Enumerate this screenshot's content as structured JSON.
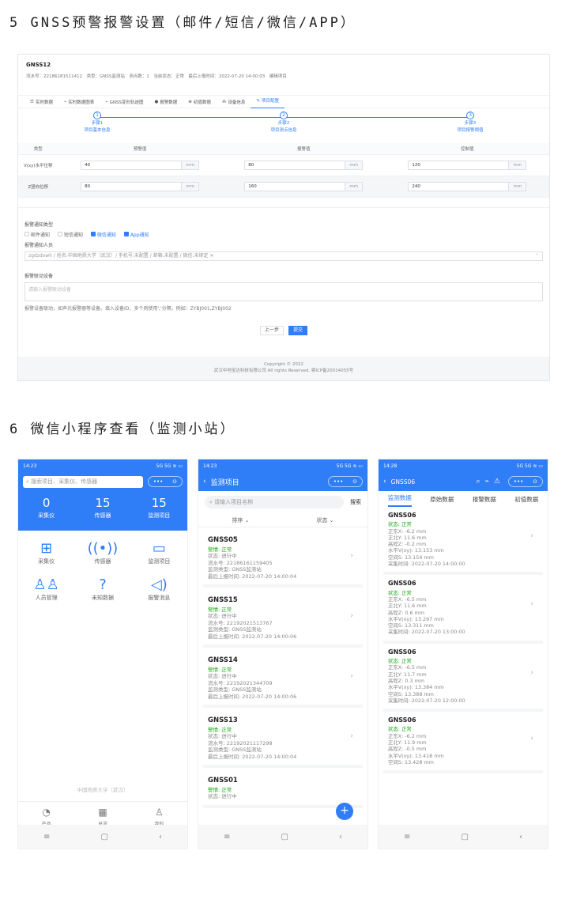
{
  "sec5_title": "5 GNSS预警报警设置（邮件/短信/微信/APP）",
  "sec6_title": "6 微信小程序查看（监测小站）",
  "web": {
    "name": "GNSS12",
    "meta": "流水号：22186181511412　类型：GNSS监测站　测点数：1　当前状态：正常　最后上报时间：2022-07-20 14:00:03　编辑项目",
    "tabs": [
      "实时数据",
      "实时数据图表",
      "GNSS变形轨迹图",
      "报警数据",
      "初值数据",
      "设备信息",
      "项目配置"
    ],
    "steps": [
      {
        "n": "1",
        "t1": "步骤1",
        "t2": "项目基本信息"
      },
      {
        "n": "2",
        "t1": "步骤2",
        "t2": "项目测点信息"
      },
      {
        "n": "3",
        "t1": "步骤3",
        "t2": "项目报警阈值"
      }
    ],
    "table_headers": [
      "类型",
      "预警值",
      "报警值",
      "控制值"
    ],
    "rows": [
      {
        "type": "V(xy)水平位移",
        "warn": "40",
        "alarm": "80",
        "control": "120",
        "unit": "mm"
      },
      {
        "type": "Z竖向位移",
        "warn": "80",
        "alarm": "160",
        "control": "240",
        "unit": "mm"
      }
    ],
    "notify_type_label": "报警通知类型",
    "notify_options": [
      "邮件通知",
      "短信通知",
      "微信通知",
      "App通知"
    ],
    "notify_person_label": "报警通知人员",
    "notify_person_value": "zgdzdxwh / 姓名:中国地质大学（武汉）/ 手机号:未配置 / 邮箱:未配置 / 微信:未绑定 ✕",
    "linkage_label": "报警联动设备",
    "linkage_placeholder": "请输入报警联动设备",
    "linkage_hint": "报警设备联动，如声光报警器等设备。填入设备ID，多个则使用','分隔，例如：ZYBJ001,ZYBJ002",
    "btn_prev": "上一步",
    "btn_submit": "提交",
    "footer1": "Copyright © 2022",
    "footer2": "武汉中地宝达科技有限公司 All rights Reserved.  鄂ICP备20014055号"
  },
  "phone1": {
    "time": "14:23",
    "signal": "5G 5G ≋ ▭",
    "search_placeholder": "搜索项目、采集仪、传感器",
    "stats": [
      {
        "n": "0",
        "l": "采集仪"
      },
      {
        "n": "15",
        "l": "传感器"
      },
      {
        "n": "15",
        "l": "监测项目"
      }
    ],
    "grid": [
      {
        "icon": "⊞",
        "l": "采集仪"
      },
      {
        "icon": "((•))",
        "l": "传感器"
      },
      {
        "icon": "▭",
        "l": "监测项目"
      },
      {
        "icon": "♙♙",
        "l": "人员管理"
      },
      {
        "icon": "?",
        "l": "未知数据"
      },
      {
        "icon": "◁)",
        "l": "报警消息"
      }
    ],
    "org": "中国地质大学（武汉）",
    "tabs": [
      {
        "icon": "◔",
        "l": "产品"
      },
      {
        "icon": "▦",
        "l": "总览"
      },
      {
        "icon": "♙",
        "l": "我的"
      }
    ]
  },
  "phone2": {
    "time": "14:23",
    "title": "监测项目",
    "search_placeholder": "请输入项目名称",
    "search_btn": "搜索",
    "filter_sort": "排序",
    "filter_state": "状态",
    "cards": [
      {
        "name": "GNSS05",
        "warn": "警情: 正常",
        "state": "状态: 进行中",
        "sn": "流水号: 22186161159405",
        "type": "监测类型: GNSS监测站",
        "time": "最后上报时间: 2022-07-20 14:00:04"
      },
      {
        "name": "GNSS15",
        "warn": "警情: 正常",
        "state": "状态: 进行中",
        "sn": "流水号: 22192021513767",
        "type": "监测类型: GNSS监测站",
        "time": "最后上报时间: 2022-07-20 14:00:06"
      },
      {
        "name": "GNSS14",
        "warn": "警情: 正常",
        "state": "状态: 进行中",
        "sn": "流水号: 22192021344709",
        "type": "监测类型: GNSS监测站",
        "time": "最后上报时间: 2022-07-20 14:00:06"
      },
      {
        "name": "GNSS13",
        "warn": "警情: 正常",
        "state": "状态: 进行中",
        "sn": "流水号: 22192021117298",
        "type": "监测类型: GNSS监测站",
        "time": "最后上报时间: 2022-07-20 14:00:04"
      },
      {
        "name": "GNSS01",
        "warn": "警情: 正常",
        "state": "状态: 进行中",
        "sn": "",
        "type": "",
        "time": ""
      }
    ]
  },
  "phone3": {
    "time": "14:28",
    "title": "GNSS06",
    "tabs": [
      "监测数据",
      "原始数据",
      "报警数据",
      "初值数据"
    ],
    "cards": [
      {
        "name": "GNSS06",
        "state": "状态: 正常",
        "x": "正东X: -6.2 mm",
        "y": "正北Y: 11.6 mm",
        "z": "高程Z: -0.2 mm",
        "v": "水平V(xy): 13.153 mm",
        "s": "空间S: 13.154 mm",
        "t": "采集时间: 2022-07-20 14:00:00"
      },
      {
        "name": "GNSS06",
        "state": "状态: 正常",
        "x": "正东X: -6.5 mm",
        "y": "正北Y: 11.6 mm",
        "z": "高程Z: 0.6 mm",
        "v": "水平V(xy): 13.297 mm",
        "s": "空间S: 13.311 mm",
        "t": "采集时间: 2022-07-20 13:00:00"
      },
      {
        "name": "GNSS06",
        "state": "状态: 正常",
        "x": "正东X: -6.5 mm",
        "y": "正北Y: 11.7 mm",
        "z": "高程Z: 0.3 mm",
        "v": "水平V(xy): 13.384 mm",
        "s": "空间S: 13.388 mm",
        "t": "采集时间: 2022-07-20 12:00:00"
      },
      {
        "name": "GNSS06",
        "state": "状态: 正常",
        "x": "正东X: -6.2 mm",
        "y": "正北Y: 11.9 mm",
        "z": "高程Z: -0.5 mm",
        "v": "水平V(xy): 13.418 mm",
        "s": "空间S: 13.428 mm",
        "t": ""
      }
    ]
  },
  "nav_keys": [
    "≡",
    "▢",
    "‹"
  ],
  "colors": {
    "primary": "#2f7df7",
    "ok": "#1aad19"
  }
}
